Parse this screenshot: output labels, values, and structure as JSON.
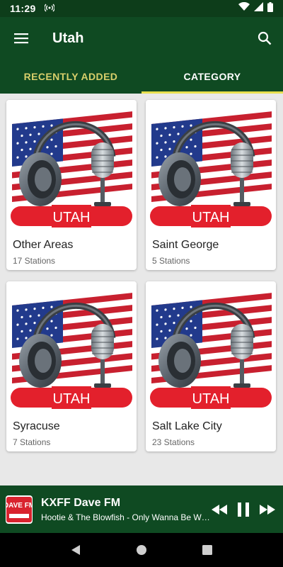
{
  "status": {
    "time": "11:29"
  },
  "app_bar": {
    "title": "Utah"
  },
  "tabs": [
    {
      "label": "RECENTLY ADDED",
      "active": false
    },
    {
      "label": "CATEGORY",
      "active": true
    }
  ],
  "cards": [
    {
      "title": "Other Areas",
      "subtitle": "17 Stations",
      "image_label": "UTAH"
    },
    {
      "title": "Saint George",
      "subtitle": "5 Stations",
      "image_label": "UTAH"
    },
    {
      "title": "Syracuse",
      "subtitle": "7 Stations",
      "image_label": "UTAH"
    },
    {
      "title": "Salt Lake City",
      "subtitle": "23 Stations",
      "image_label": "UTAH"
    }
  ],
  "player": {
    "station": "KXFF Dave FM",
    "song": "Hootie & The Blowfish - Only Wanna Be With You",
    "logo_text": "DAVE FM"
  },
  "colors": {
    "app_bar": "#0f4a22",
    "status_bar": "#0d3d1a",
    "tab_indicator": "#e7df4e",
    "background": "#e8e8e8"
  }
}
